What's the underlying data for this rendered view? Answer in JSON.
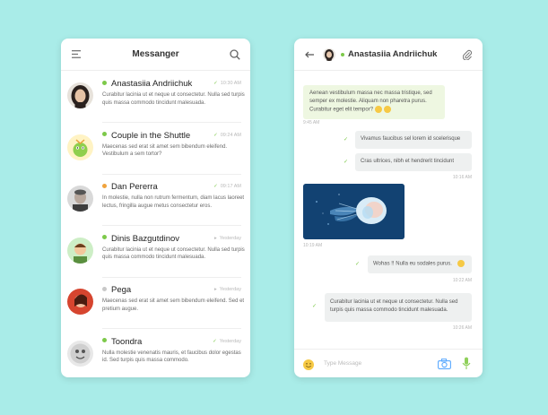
{
  "colors": {
    "background": "#a9ece8",
    "online": "#7dc94a",
    "away": "#f0a33d",
    "offline": "#c8c8c8",
    "accent": "#5aa9ff"
  },
  "messenger": {
    "title": "Messanger",
    "icons": {
      "menu": "hamburger-icon",
      "search": "search-icon"
    },
    "conversations": [
      {
        "name": "Anastasiia Andriichuk",
        "status": "online",
        "time": "10:30 AM",
        "ticked": true,
        "preview": "Curabitur lacinia ut et neque ut consectetur. Nulla sed turpis quis massa commodo tincidunt malesuada."
      },
      {
        "name": "Couple in the Shuttle",
        "status": "online",
        "time": "09:24 AM",
        "ticked": true,
        "preview": "Maecenas sed erat sit amet sem bibendum eleifend. Vestibulum a sem tortor?"
      },
      {
        "name": "Dan Pererra",
        "status": "away",
        "time": "09:17 AM",
        "ticked": true,
        "preview": "In molestie, nulla non rutrum fermentum, diam lacus laoreet lectus, fringilla augue metus consectetur eros."
      },
      {
        "name": "Dinis Bazgutdinov",
        "status": "online",
        "time": "Yesterday",
        "ticked": false,
        "preview": "Curabitur lacinia ut et neque ut consectetur. Nulla sed turpis quis massa commodo tincidunt malesuada."
      },
      {
        "name": "Pega",
        "status": "offline",
        "time": "Yesterday",
        "ticked": false,
        "preview": "Maecenas sed erat sit amet sem bibendum eleifend. Sed et pretium augue."
      },
      {
        "name": "Toondra",
        "status": "online",
        "time": "Yesterday",
        "ticked": true,
        "preview": "Nulla molestie venenatis mauris, et faucibus dolor egestas id. Sed turpis quis massa commodo."
      }
    ]
  },
  "chat": {
    "contact_name": "Anastasiia Andriichuk",
    "icons": {
      "back": "arrow-left-icon",
      "attach": "paperclip-icon",
      "emoji": "smile-icon",
      "camera": "camera-icon",
      "mic": "microphone-icon"
    },
    "incoming_message": {
      "text": "Aenean vestibulum massa nec massa tristique, sed semper ex molestie. Aliquam non pharetra purus. Curabitur eget elit tempor?",
      "time": "9:45 AM"
    },
    "outgoing_1": "Vivamus faucibus sel lorem id scelerisque",
    "outgoing_2": "Cras ultrices, nibh et hendrerit tincidunt",
    "outgoing_time": "10:16 AM",
    "image_time": "10:19 AM",
    "outgoing_3": "Wohas !! Nulla eu sodales purus.",
    "outgoing_3_time": "10:22 AM",
    "outgoing_4": "Curabitur lacinia ut et neque ut consectetur. Nulla sed turpis quis massa commodo tincidunt malesuada.",
    "outgoing_4_time": "10:26 AM",
    "composer_placeholder": "Type Message"
  }
}
